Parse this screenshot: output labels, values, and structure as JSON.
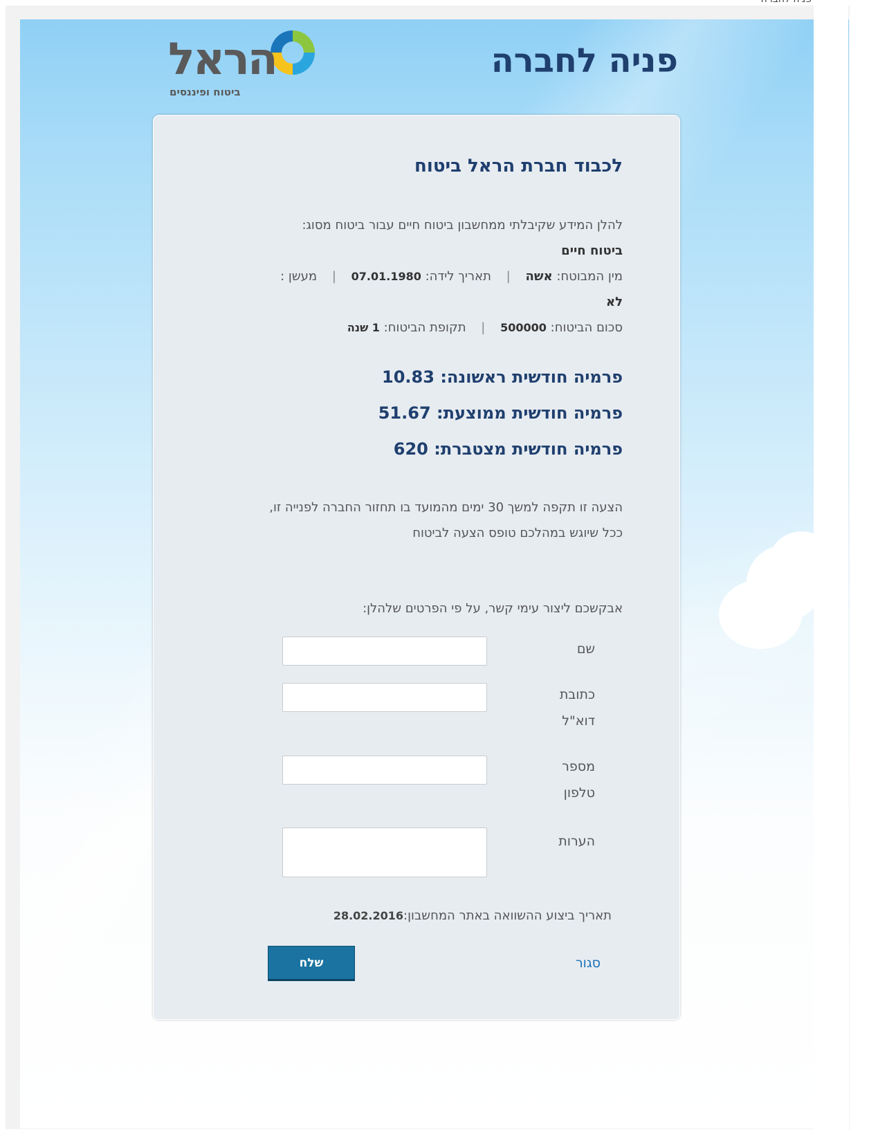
{
  "top_cut_text": "פניה לחברה",
  "header": {
    "title": "פניה לחברה",
    "logo_text": "הראל",
    "logo_subtitle": "ביטוח ופיננסים"
  },
  "panel": {
    "title": "לכבוד חברת הראל ביטוח",
    "intro": "להלן המידע שקיבלתי ממחשבון ביטוח חיים עבור ביטוח מסוג:",
    "insurance_type": "ביטוח חיים",
    "gender_label": "מין המבוטח:",
    "gender_value": "אשה",
    "birthdate_label": "תאריך לידה:",
    "birthdate_value": "07.01.1980",
    "smoker_label": "מעשן :",
    "smoker_value": "לא",
    "sum_label": "סכום הביטוח:",
    "sum_value": "500000",
    "period_label": "תקופת הביטוח:",
    "period_value": "1 שנה",
    "separator": "|"
  },
  "premiums": [
    {
      "label": "פרמיה חודשית ראשונה:",
      "value": "10.83"
    },
    {
      "label": "פרמיה חודשית ממוצעת:",
      "value": "51.67"
    },
    {
      "label": "פרמיה חודשית מצטברת:",
      "value": "620"
    }
  ],
  "offer": {
    "line1": "הצעה זו תקפה למשך 30 ימים מהמועד בו תחזור החברה לפנייה זו,",
    "line2": "ככל שיוגש במהלכם טופס הצעה לביטוח"
  },
  "contact": {
    "intro": "אבקשכם ליצור עימי קשר, על פי הפרטים שלהלן:",
    "fields": [
      {
        "label": "שם",
        "value": ""
      },
      {
        "label": "כתובת דוא\"ל",
        "value": ""
      },
      {
        "label": "מספר טלפון",
        "value": ""
      },
      {
        "label": "הערות",
        "value": ""
      }
    ]
  },
  "footer": {
    "date_label": "תאריך ביצוע ההשוואה באתר המחשבון:",
    "date_value": "28.02.2016",
    "close_label": "סגור",
    "send_label": "שלח"
  },
  "colors": {
    "title": "#1f3f6e",
    "button": "#1a73a0",
    "link": "#1a72b8",
    "panel": "#e7ecf1"
  }
}
